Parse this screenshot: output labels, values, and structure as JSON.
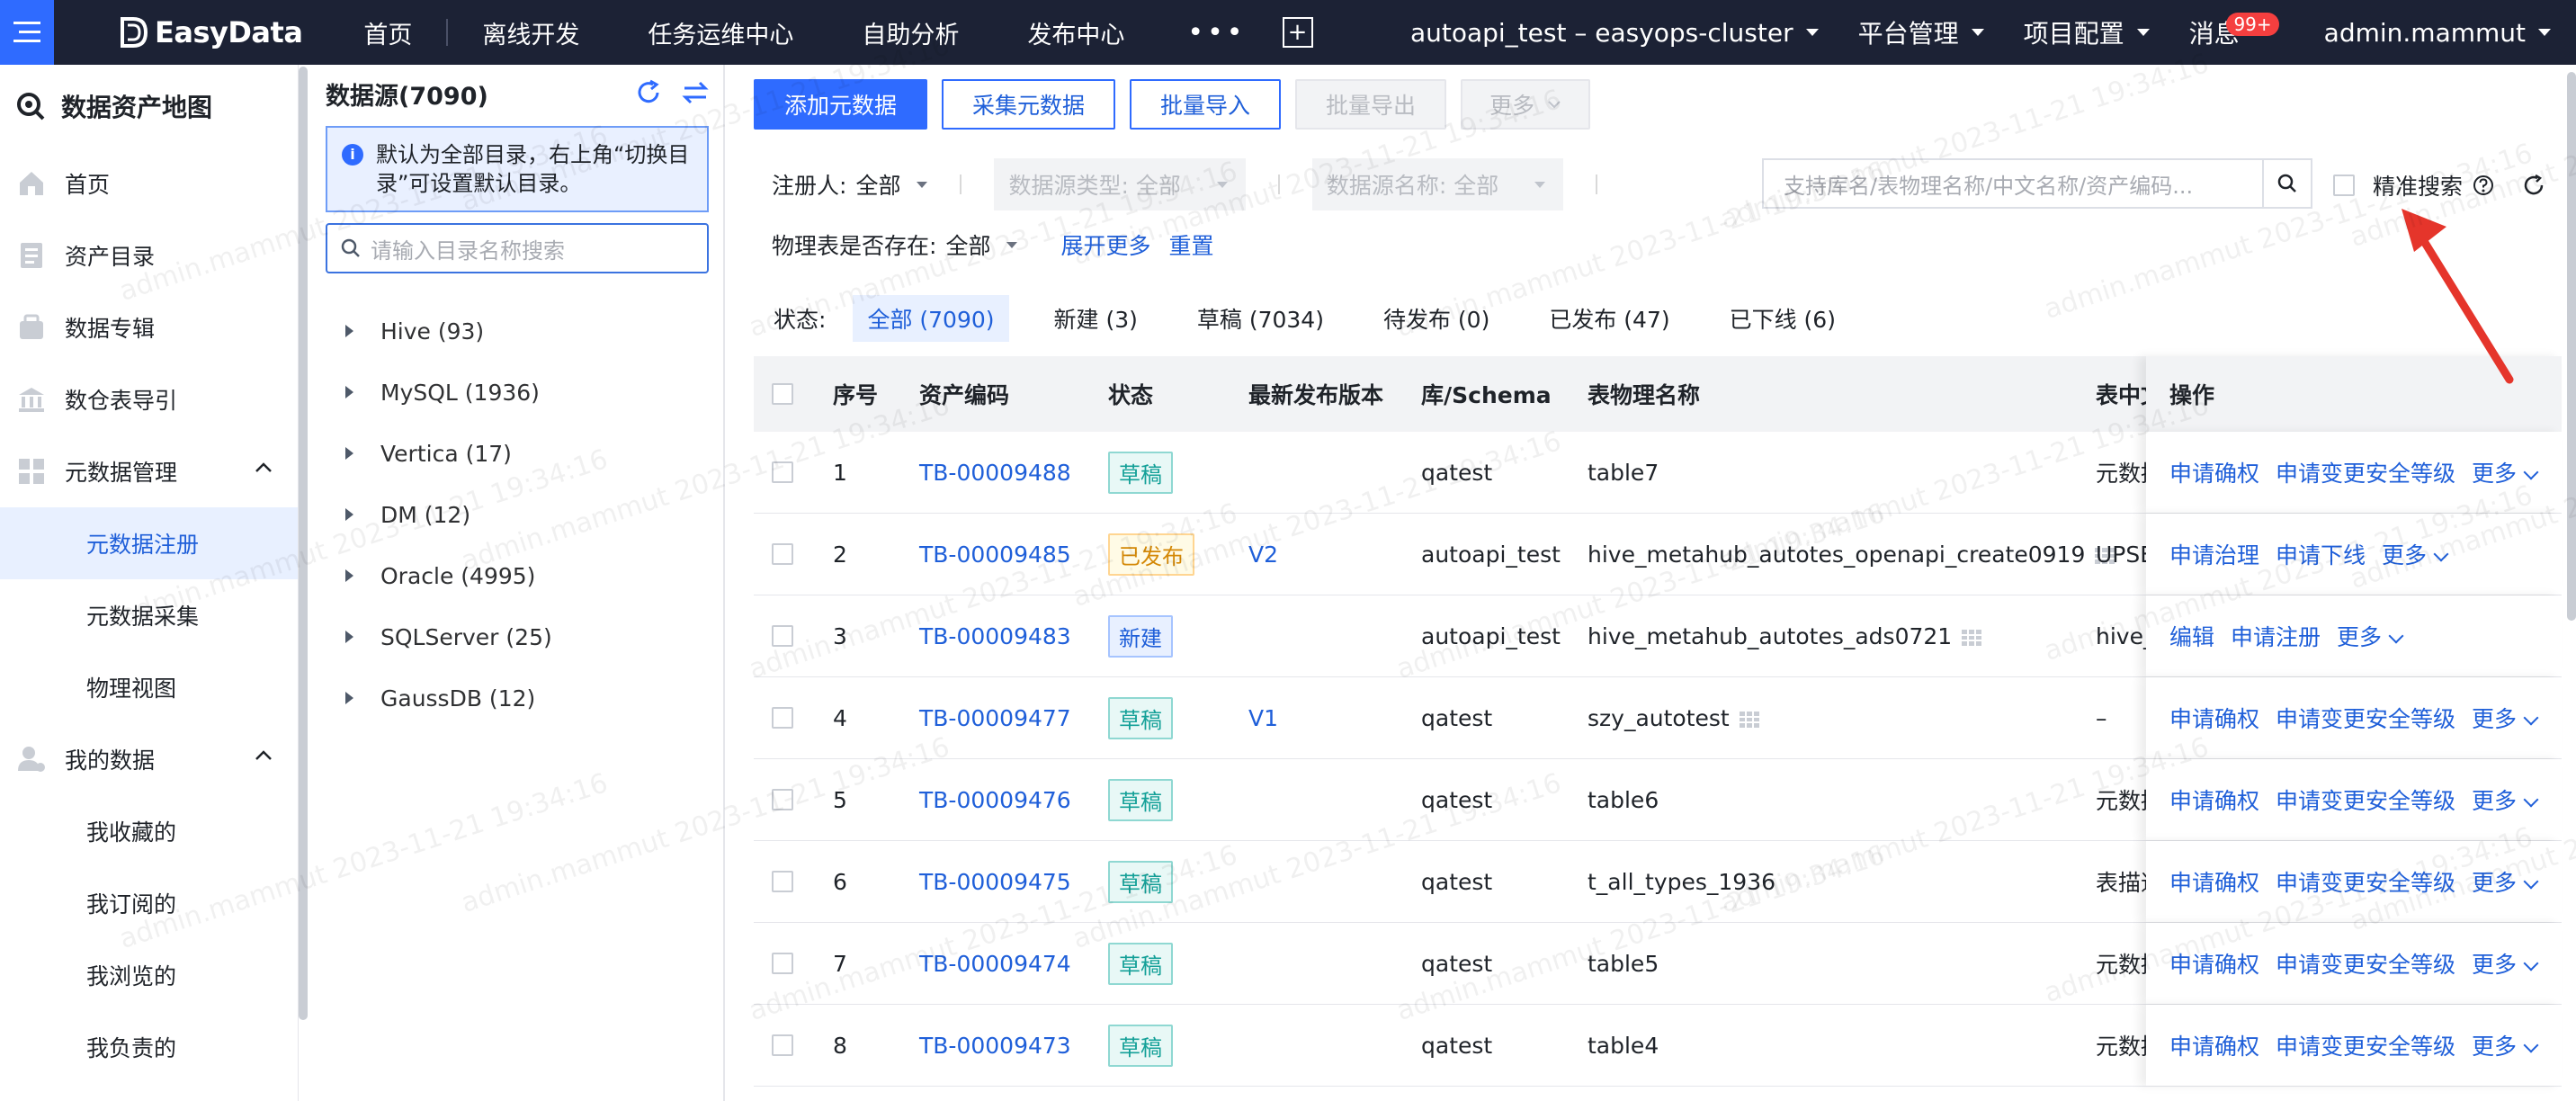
{
  "topnav": {
    "brand": "EasyData",
    "items": [
      "首页",
      "离线开发",
      "任务运维中心",
      "自助分析",
      "发布中心"
    ],
    "more": "•••",
    "add": "+",
    "project": "autoapi_test – easyops-cluster",
    "platform": "平台管理",
    "config": "项目配置",
    "messages": "消息",
    "msg_badge": "99+",
    "user": "admin.mammut"
  },
  "sidebar": {
    "title": "数据资产地图",
    "items": [
      {
        "label": "首页",
        "icon": "home-icon"
      },
      {
        "label": "资产目录",
        "icon": "catalog-icon"
      },
      {
        "label": "数据专辑",
        "icon": "album-icon"
      },
      {
        "label": "数仓表导引",
        "icon": "warehouse-icon"
      }
    ],
    "group1": "元数据管理",
    "group1_subs": [
      "元数据注册",
      "元数据采集",
      "物理视图"
    ],
    "group2": "我的数据",
    "group2_subs": [
      "我收藏的",
      "我订阅的",
      "我浏览的",
      "我负责的"
    ]
  },
  "tree": {
    "title": "数据源(7090)",
    "info": "默认为全部目录，右上角“切换目录”可设置默认目录。",
    "search_placeholder": "请输入目录名称搜索",
    "nodes": [
      "Hive (93)",
      "MySQL (1936)",
      "Vertica (17)",
      "DM (12)",
      "Oracle (4995)",
      "SQLServer (25)",
      "GaussDB (12)"
    ]
  },
  "toolbar": {
    "add": "添加元数据",
    "collect": "采集元数据",
    "import": "批量导入",
    "export": "批量导出",
    "more": "更多"
  },
  "filters": {
    "registrant_label": "注册人:",
    "registrant_value": "全部",
    "ds_type": "数据源类型: 全部",
    "ds_name": "数据源名称: 全部",
    "search_placeholder": "支持库名/表物理名称/中文名称/资产编码...",
    "precise": "精准搜索",
    "exists_label": "物理表是否存在:",
    "exists_value": "全部",
    "expand": "展开更多",
    "reset": "重置"
  },
  "status": {
    "label": "状态:",
    "tabs": [
      "全部 (7090)",
      "新建 (3)",
      "草稿 (7034)",
      "待发布 (0)",
      "已发布 (47)",
      "已下线 (6)"
    ]
  },
  "table": {
    "headers": [
      "序号",
      "资产编码",
      "状态",
      "最新发布版本",
      "库/Schema",
      "表物理名称",
      "表中文",
      "操作"
    ],
    "rows": [
      {
        "no": "1",
        "code": "TB-00009488",
        "status": "草稿",
        "type": "draft",
        "ver": "",
        "schema": "qatest",
        "name": "table7",
        "grid": false,
        "cn": "元数据",
        "ops": [
          "申请确权",
          "申请变更安全等级",
          "更多"
        ]
      },
      {
        "no": "2",
        "code": "TB-00009485",
        "status": "已发布",
        "type": "pub",
        "ver": "V2",
        "schema": "autoapi_test",
        "name": "hive_metahub_autotes_openapi_create0919",
        "grid": true,
        "cn": "UPSE",
        "ops": [
          "申请治理",
          "申请下线",
          "更多"
        ]
      },
      {
        "no": "3",
        "code": "TB-00009483",
        "status": "新建",
        "type": "new",
        "ver": "",
        "schema": "autoapi_test",
        "name": "hive_metahub_autotes_ads0721",
        "grid": true,
        "cn": "hive_m",
        "ops": [
          "编辑",
          "申请注册",
          "更多"
        ]
      },
      {
        "no": "4",
        "code": "TB-00009477",
        "status": "草稿",
        "type": "draft",
        "ver": "V1",
        "schema": "qatest",
        "name": "szy_autotest",
        "grid": true,
        "cn": "–",
        "ops": [
          "申请确权",
          "申请变更安全等级",
          "更多"
        ]
      },
      {
        "no": "5",
        "code": "TB-00009476",
        "status": "草稿",
        "type": "draft",
        "ver": "",
        "schema": "qatest",
        "name": "table6",
        "grid": false,
        "cn": "元数据",
        "ops": [
          "申请确权",
          "申请变更安全等级",
          "更多"
        ]
      },
      {
        "no": "6",
        "code": "TB-00009475",
        "status": "草稿",
        "type": "draft",
        "ver": "",
        "schema": "qatest",
        "name": "t_all_types_1936",
        "grid": false,
        "cn": "表描述",
        "ops": [
          "申请确权",
          "申请变更安全等级",
          "更多"
        ]
      },
      {
        "no": "7",
        "code": "TB-00009474",
        "status": "草稿",
        "type": "draft",
        "ver": "",
        "schema": "qatest",
        "name": "table5",
        "grid": false,
        "cn": "元数据",
        "ops": [
          "申请确权",
          "申请变更安全等级",
          "更多"
        ]
      },
      {
        "no": "8",
        "code": "TB-00009473",
        "status": "草稿",
        "type": "draft",
        "ver": "",
        "schema": "qatest",
        "name": "table4",
        "grid": false,
        "cn": "元数据",
        "ops": [
          "申请确权",
          "申请变更安全等级",
          "更多"
        ]
      }
    ]
  },
  "watermark": "admin.mammut 2023-11-21 19:34:16",
  "colors": {
    "primary": "#2f6bff",
    "nav_bg": "#1c2235",
    "arrow": "#e5352b"
  }
}
